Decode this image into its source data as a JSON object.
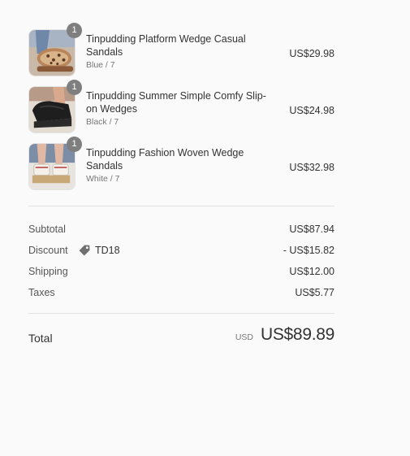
{
  "items": [
    {
      "quantity": "1",
      "name": "Tinpudding Platform Wedge Casual Sandals",
      "variant": "Blue / 7",
      "price": "US$29.98",
      "image": "leopard-sandal-photo"
    },
    {
      "quantity": "1",
      "name": "Tinpudding Summer Simple Comfy Slip-on Wedges",
      "variant": "Black / 7",
      "price": "US$24.98",
      "image": "black-wedge-photo"
    },
    {
      "quantity": "1",
      "name": "Tinpudding Fashion Woven Wedge Sandals",
      "variant": "White / 7",
      "price": "US$32.98",
      "image": "white-wedge-photo"
    }
  ],
  "totals": {
    "subtotal_label": "Subtotal",
    "subtotal_value": "US$87.94",
    "discount_label": "Discount",
    "discount_code": "TD18",
    "discount_icon": "tag-icon",
    "discount_value": "- US$15.82",
    "shipping_label": "Shipping",
    "shipping_value": "US$12.00",
    "taxes_label": "Taxes",
    "taxes_value": "US$5.77"
  },
  "total": {
    "label": "Total",
    "currency": "USD",
    "amount": "US$89.89"
  }
}
